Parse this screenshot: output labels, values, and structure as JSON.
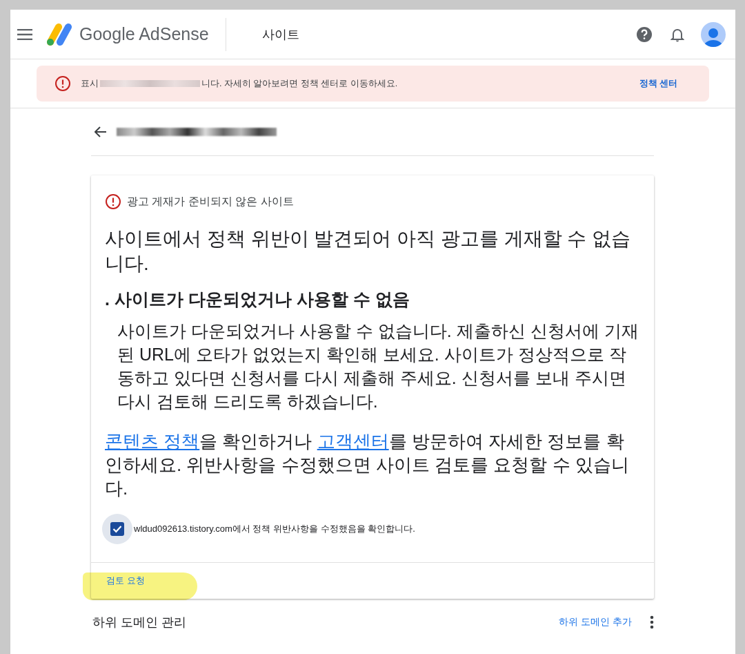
{
  "header": {
    "logo_text": "Google AdSense",
    "page_title": "사이트"
  },
  "banner": {
    "text_start": "표시",
    "text_end": "니다. 자세히 알아보려면 정책 센터로 이동하세요.",
    "link": "정책 센터"
  },
  "site_card": {
    "status": "광고 게재가 준비되지 않은 사이트",
    "title": "사이트에서 정책 위반이 발견되어 아직 광고를 게재할 수 없습니다.",
    "issue_heading": ". 사이트가 다운되었거나 사용할 수 없음",
    "issue_body": "사이트가 다운되었거나 사용할 수 없습니다. 제출하신 신청서에 기재된 URL에 오타가 없었는지 확인해 보세요. 사이트가 정상적으로 작동하고 있다면 신청서를 다시 제출해 주세요. 신청서를 보내 주시면 다시 검토해 드리도록 하겠습니다.",
    "help_parts": [
      {
        "kind": "link",
        "text": "콘텐츠 정책"
      },
      {
        "kind": "text",
        "text": "을 확인하거나 "
      },
      {
        "kind": "link",
        "text": "고객센터"
      },
      {
        "kind": "text",
        "text": "를 방문하여 자세한 정보를 확인하세요. 위반사항을 수정했으면 사이트 검토를 요청할 수 있습니다."
      }
    ],
    "confirm": {
      "label": "wldud092613.tistory.com에서 정책 위반사항을 수정했음을 확인합니다.",
      "checked": true
    },
    "action": "검토 요청"
  },
  "subdomains": {
    "title": "하위 도메인 관리",
    "action": "하위 도메인 추가"
  }
}
